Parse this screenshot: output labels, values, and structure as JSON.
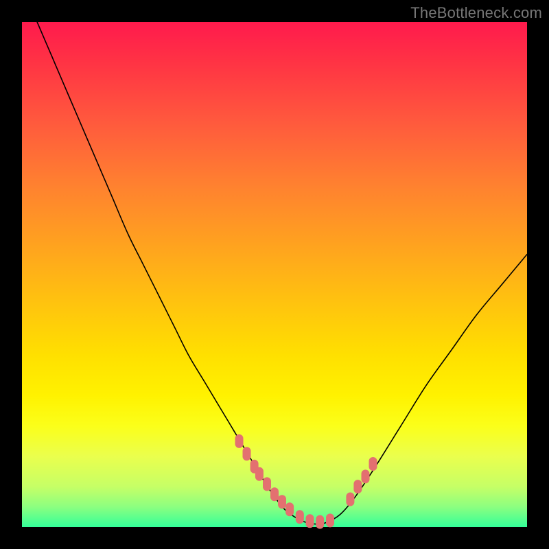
{
  "watermark": "TheBottleneck.com",
  "colors": {
    "frame": "#000000",
    "marker": "#e37070",
    "curve": "#000000"
  },
  "chart_data": {
    "type": "line",
    "title": "",
    "xlabel": "",
    "ylabel": "",
    "xlim": [
      0,
      100
    ],
    "ylim": [
      0,
      100
    ],
    "grid": false,
    "legend": false,
    "series": [
      {
        "name": "bottleneck-curve",
        "x": [
          3,
          6,
          9,
          12,
          15,
          18,
          21,
          24,
          27,
          30,
          33,
          36,
          39,
          42,
          45,
          48,
          50,
          52,
          54,
          56,
          58,
          60,
          63,
          66,
          70,
          75,
          80,
          85,
          90,
          95,
          100
        ],
        "y": [
          100,
          93,
          86,
          79,
          72,
          65,
          58,
          52,
          46,
          40,
          34,
          29,
          24,
          19,
          14,
          9,
          6,
          3.5,
          2,
          1,
          0.6,
          0.8,
          2.5,
          6,
          12,
          20,
          28,
          35,
          42,
          48,
          54
        ]
      }
    ],
    "markers": {
      "name": "highlight-dots",
      "x": [
        43,
        44.5,
        46,
        47,
        48.5,
        50,
        51.5,
        53,
        55,
        57,
        59,
        61,
        65,
        66.5,
        68,
        69.5
      ],
      "y": [
        17,
        14.5,
        12,
        10.5,
        8.5,
        6.5,
        5,
        3.5,
        2,
        1.2,
        1,
        1.3,
        5.5,
        8,
        10,
        12.5
      ]
    }
  }
}
